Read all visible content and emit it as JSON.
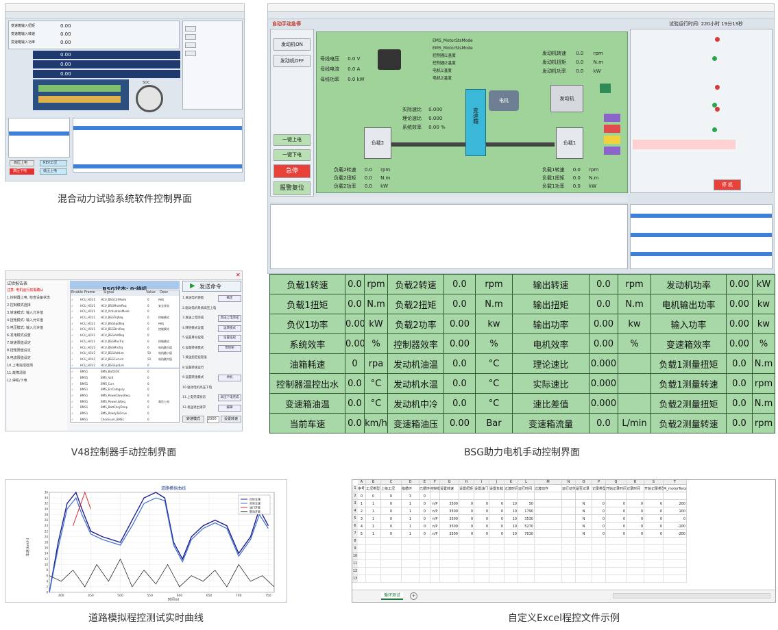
{
  "captions": {
    "hybrid": "混合动力试验系统软件控制界面",
    "v48": "V48控制器手动控制界面",
    "bsg": "BSG助力电机手动控制界面",
    "road": "道路模拟程控测试实时曲线",
    "excel": "自定义Excel程控文件示例"
  },
  "hybrid_screen": {
    "values_left": [
      {
        "label": "变速箱输入扭矩",
        "value": "0.00"
      },
      {
        "label": "变速箱输入转速",
        "value": "0.00"
      },
      {
        "label": "变速箱输入功率",
        "value": "0.00"
      }
    ],
    "mid_values": [
      "0.00",
      "0.00",
      "0.00",
      "0"
    ],
    "gauge_label": "SOC",
    "buttons_left": [
      "高压上电",
      "低压上电"
    ],
    "status_red": "高压下电",
    "status_blue": "REV工况"
  },
  "bsg_screen": {
    "header_left": "自动手动急停",
    "top_buttons": [
      "发动机ON",
      "发动机OFF"
    ],
    "side_buttons": [
      "一键上电",
      "一键下电",
      "急停",
      "报警复位"
    ],
    "center_label": "变速箱",
    "motor_label": "电机",
    "engine_label": "发动机",
    "load1": "负载1",
    "load2": "负载2",
    "ecu_lines": [
      "EMS_MotorStsMode",
      "EMS_MotorStsMode",
      "控制器1温度",
      "控制器2温度",
      "电机1温度",
      "电机2温度"
    ],
    "left_readouts": [
      {
        "label": "母线电压",
        "value": "0.0",
        "unit": "V"
      },
      {
        "label": "母线电流",
        "value": "0.0",
        "unit": "A"
      },
      {
        "label": "母线功率",
        "value": "0.0",
        "unit": "kW"
      }
    ],
    "right_readouts": [
      {
        "label": "发动机转速",
        "value": "0.0",
        "unit": "rpm"
      },
      {
        "label": "发动机扭矩",
        "value": "0.0",
        "unit": "N.m"
      },
      {
        "label": "发动机功率",
        "value": "0.0",
        "unit": "kW"
      }
    ],
    "efficiency": [
      {
        "label": "实际速比",
        "value": "0.000"
      },
      {
        "label": "理论速比",
        "value": "0.000"
      },
      {
        "label": "系统效率",
        "value": "0.00",
        "unit": "%"
      }
    ],
    "load2_readouts": [
      {
        "label": "负载2转速",
        "value": "0.0",
        "unit": "rpm"
      },
      {
        "label": "负载2扭矩",
        "value": "0.0",
        "unit": "N.m"
      },
      {
        "label": "负载2功率",
        "value": "0.0",
        "unit": "kW"
      }
    ],
    "load1_readouts": [
      {
        "label": "负载1转速",
        "value": "0.0",
        "unit": "rpm"
      },
      {
        "label": "负载1扭矩",
        "value": "0.0",
        "unit": "N.m"
      },
      {
        "label": "负载1功率",
        "value": "0.0",
        "unit": "kW"
      }
    ],
    "right_stop_button": "停 机",
    "status_bar": "试验运行时间: 220小时 19分13秒"
  },
  "v48_screen": {
    "state_title": "BSG状态: 0:待机",
    "send_button": "发送命令",
    "left_title": "试验报告表",
    "left_notes": [
      "注意: 电机运行前需确认",
      "1.控制器上电, 检查设备状态",
      "2.控制模式选择",
      "3.转速模式: 输入允许值",
      "4.扭矩模式: 输入允许值",
      "5.电压模式: 输入允许值",
      "6.发电模式设置",
      "7.转速限值设定",
      "8.扭矩限值设定",
      "9.电流限值设定",
      "10.上电完成检测",
      "11.故障清除",
      "12.停机/下电"
    ],
    "table_headers": [
      "Enable",
      "Frame",
      "Signal",
      "Value",
      "Desc"
    ],
    "rows": [
      {
        "f": "HCU_HCU1",
        "s": "HCU_BSGCtrlMode",
        "v": "0",
        "d": "待机"
      },
      {
        "f": "HCU_HCU1",
        "s": "HCU_BSGModeReq",
        "v": "0",
        "d": "安全状态"
      },
      {
        "f": "HCU_HCU1",
        "s": "HCU_ActivationMode",
        "v": "0",
        "d": ""
      },
      {
        "f": "HCU_HCU1",
        "s": "HCU_BSGTrqReq",
        "v": "0",
        "d": "控制模式"
      },
      {
        "f": "HCU_HCU1",
        "s": "HCU_BSGSpdReq",
        "v": "0",
        "d": "待机"
      },
      {
        "f": "HCU_HCU1",
        "s": "HCU_BSGDircReq",
        "v": "0",
        "d": "控制模式"
      },
      {
        "f": "HCU_HCU1",
        "s": "HCU_BSGVoltReq",
        "v": "0",
        "d": ""
      },
      {
        "f": "HCU_HCU1",
        "s": "HCU_BSGMaxTrq",
        "v": "0",
        "d": "控制模式"
      },
      {
        "f": "HCU_HCU2",
        "s": "HCU_BSGMinTrq",
        "v": "0",
        "d": "电机最大值"
      },
      {
        "f": "HCU_HCU2",
        "s": "HCU_BSGVoltLim",
        "v": "50",
        "d": "电机最小值"
      },
      {
        "f": "HCU_HCU2",
        "s": "HCU_BSGCurLim",
        "v": "50",
        "d": "电机最大值"
      },
      {
        "f": "HCU_HCU2",
        "s": "HCU_BSGSpdLim",
        "v": "0",
        "d": ""
      },
      {
        "f": "BMS1",
        "s": "BMS_BattSOC",
        "v": "0",
        "d": ""
      },
      {
        "f": "BMS1",
        "s": "BMS_Volt",
        "v": "0",
        "d": ""
      },
      {
        "f": "BMS1",
        "s": "BMS_Curr",
        "v": "0",
        "d": ""
      },
      {
        "f": "BMS1",
        "s": "BMS_ErrCategory",
        "v": "0",
        "d": ""
      },
      {
        "f": "BMS1",
        "s": "BMS_PowerDownReq",
        "v": "0",
        "d": ""
      },
      {
        "f": "BMS1",
        "s": "BMS_PowerUpReq",
        "v": "0",
        "d": "高压上电"
      },
      {
        "f": "BMS1",
        "s": "BMS_BattChrgTemp",
        "v": "0",
        "d": ""
      },
      {
        "f": "BMS1",
        "s": "BMS_ReadyToDrive",
        "v": "0",
        "d": ""
      },
      {
        "f": "BMS1",
        "s": "Checksum_BMS1",
        "v": "0",
        "d": ""
      }
    ],
    "cmd_items": [
      {
        "label": "1.发送电机使能",
        "btn": "确定"
      },
      {
        "label": "2.驱动电机系统高压上电",
        "btn": ""
      },
      {
        "label": "3.发送上电完成",
        "btn": "高压上电完成"
      },
      {
        "label": "4.转矩模式设置",
        "btn": "运转模式"
      },
      {
        "label": "5.设置目标扭矩",
        "btn": "设置扭矩"
      },
      {
        "label": "6.设置转速模式",
        "btn": "零转矩"
      },
      {
        "label": "7.发送指定扭矩值",
        "btn": ""
      },
      {
        "label": "8.设置转速运行",
        "btn": ""
      },
      {
        "label": "9.设置转速模式",
        "btn": "待机"
      },
      {
        "label": "10.驱动电机高压下电",
        "btn": ""
      },
      {
        "label": "11.上电完成状态",
        "btn": "高压下电完成"
      },
      {
        "label": "12.发送退出请求",
        "btn": "编辑"
      }
    ],
    "bottom_btn1": "转速模式",
    "bottom_val": "2000",
    "bottom_btn2": "设置转速",
    "input_val": "25"
  },
  "bsg_table": {
    "rows": [
      [
        [
          "负载1转速",
          "0.0",
          "rpm"
        ],
        [
          "负载2转速",
          "0.0",
          "rpm"
        ],
        [
          "输出转速",
          "0.0",
          "rpm"
        ],
        [
          "发动机功率",
          "0.00",
          "kW"
        ]
      ],
      [
        [
          "负载1扭矩",
          "0.0",
          "N.m"
        ],
        [
          "负载2扭矩",
          "0.0",
          "N.m"
        ],
        [
          "输出扭矩",
          "0.0",
          "N.m"
        ],
        [
          "电机输出功率",
          "0.00",
          "kw"
        ]
      ],
      [
        [
          "负仪1功率",
          "0.00",
          "kW"
        ],
        [
          "负载2功率",
          "0.00",
          "kw"
        ],
        [
          "输出功率",
          "0.00",
          "kw"
        ],
        [
          "输入功率",
          "0.00",
          "kw"
        ]
      ],
      [
        [
          "系统效率",
          "0.00",
          "%"
        ],
        [
          "控制器效率",
          "0.00",
          "%"
        ],
        [
          "电机效率",
          "0.00",
          "%"
        ],
        [
          "变速箱效率",
          "0.00",
          "%"
        ]
      ],
      [
        [
          "油箱耗速",
          "0",
          "rpa"
        ],
        [
          "发动机油温",
          "0.0",
          "°C"
        ],
        [
          "理论速比",
          "0.000",
          ""
        ],
        [
          "负载1测量扭矩",
          "0.0",
          "N.m"
        ]
      ],
      [
        [
          "控制器温控出水",
          "0.0",
          "°C"
        ],
        [
          "发动机水温",
          "0.0",
          "°C"
        ],
        [
          "实际速比",
          "0.000",
          ""
        ],
        [
          "负载1测量转速",
          "0.0",
          "rpm"
        ]
      ],
      [
        [
          "变速箱油温",
          "0.0",
          "°C"
        ],
        [
          "发动机中冷",
          "0.0",
          "°C"
        ],
        [
          "速比差值",
          "0.000",
          ""
        ],
        [
          "负载2测量扭矩",
          "0.0",
          "N.m"
        ]
      ],
      [
        [
          "当前车速",
          "0.0",
          "km/h"
        ],
        [
          "变速箱油压",
          "0.00",
          "Bar"
        ],
        [
          "变速箱流量",
          "0.0",
          "L/min"
        ],
        [
          "负载2测量转速",
          "0.0",
          "rpm"
        ]
      ]
    ]
  },
  "road_chart": {
    "title": "道路模拟曲线",
    "ylabel": "车速(km/h)",
    "xlabel": "时间(s)",
    "legend": [
      "目标车速",
      "实际车速",
      "油门开度",
      "制动开度"
    ],
    "colors": {
      "target": "#1e1e8c",
      "actual": "#3c6fd0",
      "throttle": "#d03030",
      "brake": "#101010"
    }
  },
  "chart_data": {
    "type": "line",
    "title": "道路模拟曲线",
    "xlabel": "时间(s)",
    "ylabel": "车速(km/h)",
    "xlim": [
      380,
      760
    ],
    "ylim": [
      0,
      36
    ],
    "xticks": [
      400,
      450,
      500,
      550,
      600,
      650,
      700,
      750
    ],
    "yticks": [
      0,
      2,
      4,
      6,
      8,
      10,
      12,
      14,
      16,
      18,
      20,
      22,
      24,
      26,
      28,
      30,
      32,
      34,
      36
    ],
    "series": [
      {
        "name": "目标车速",
        "x": [
          380,
          395,
          410,
          425,
          435,
          450,
          470,
          500,
          520,
          540,
          560,
          575,
          590,
          605,
          620,
          640,
          660,
          680,
          700,
          720,
          735,
          750
        ],
        "y": [
          0,
          18,
          32,
          36,
          30,
          22,
          20,
          18,
          26,
          34,
          36,
          34,
          18,
          12,
          20,
          24,
          26,
          24,
          14,
          20,
          30,
          24
        ]
      },
      {
        "name": "实际车速",
        "x": [
          380,
          395,
          410,
          425,
          435,
          450,
          470,
          500,
          520,
          540,
          560,
          575,
          590,
          605,
          620,
          640,
          660,
          680,
          700,
          720,
          735,
          750
        ],
        "y": [
          0,
          16,
          30,
          34,
          28,
          21,
          19,
          17,
          24,
          32,
          34,
          33,
          17,
          11,
          19,
          23,
          25,
          23,
          13,
          19,
          28,
          23
        ]
      },
      {
        "name": "油门开度",
        "x": [
          420,
          430,
          440,
          450
        ],
        "y": [
          24,
          30,
          36,
          30
        ]
      },
      {
        "name": "制动开度",
        "x": [
          380,
          400,
          420,
          440,
          460,
          480,
          500,
          520,
          540,
          560,
          580,
          600,
          620,
          640,
          660,
          680,
          700,
          720,
          740,
          760
        ],
        "y": [
          6,
          4,
          8,
          2,
          10,
          4,
          12,
          2,
          8,
          3,
          10,
          2,
          6,
          4,
          8,
          2,
          10,
          4,
          6,
          2
        ]
      }
    ]
  },
  "excel": {
    "col_letters": [
      "A",
      "B",
      "C",
      "D",
      "E",
      "F",
      "G",
      "H",
      "I",
      "J",
      "K",
      "L",
      "M",
      "N",
      "O",
      "P",
      "Q",
      "R",
      "S",
      "T"
    ],
    "headers": [
      "序号",
      "工况类型",
      "上级工况",
      "指循环",
      "已循环",
      "控制模式",
      "设置转速",
      "设置扭矩",
      "设置油门",
      "设置负载",
      "过渡时间",
      "运行时间",
      "过渡动作",
      "运行动作",
      "是否记录",
      "记录类型",
      "开始记录时间",
      "记录时间",
      "开始记录类型",
      "M_motorTorque"
    ],
    "rows": [
      [
        "0",
        "0",
        "0",
        "3",
        "0",
        "",
        "",
        "",
        "",
        "",
        "",
        "",
        "",
        "",
        "",
        "",
        "",
        "",
        "",
        ""
      ],
      [
        "1",
        "1",
        "0",
        "1",
        "0",
        "n/P",
        "3500",
        "0",
        "0",
        "0",
        "10",
        "50",
        "",
        "",
        "N",
        "0",
        "0",
        "0",
        "0",
        "200"
      ],
      [
        "2",
        "1",
        "0",
        "1",
        "0",
        "n/P",
        "3500",
        "0",
        "0",
        "0",
        "10",
        "1790",
        "",
        "",
        "N",
        "0",
        "0",
        "0",
        "0",
        "100"
      ],
      [
        "3",
        "1",
        "0",
        "1",
        "0",
        "n/P",
        "3500",
        "0",
        "0",
        "0",
        "10",
        "3530",
        "",
        "",
        "N",
        "0",
        "0",
        "0",
        "0",
        "0"
      ],
      [
        "4",
        "1",
        "0",
        "1",
        "0",
        "n/P",
        "3500",
        "0",
        "0",
        "0",
        "10",
        "5270",
        "",
        "",
        "N",
        "0",
        "0",
        "0",
        "0",
        "-100"
      ],
      [
        "5",
        "1",
        "0",
        "1",
        "0",
        "n/P",
        "3500",
        "0",
        "0",
        "0",
        "10",
        "7010",
        "",
        "",
        "N",
        "0",
        "0",
        "0",
        "0",
        "-200"
      ]
    ],
    "sheet_tab": "循环测试"
  }
}
